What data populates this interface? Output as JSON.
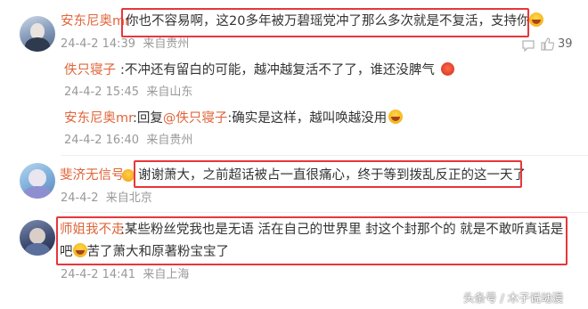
{
  "comments": [
    {
      "username": "安东尼奥mr",
      "text_before": "你也不容易啊，这20多年被万碧瑶党冲了那么多次就是不复活，支持你",
      "time": "24-4-2 14:39",
      "location": "来自贵州",
      "like_count": "39",
      "replies": [
        {
          "username": "佚只寝子",
          "text": ":不冲还有留白的可能，越冲越复活不了了，谁还没脾气",
          "time": "24-4-2 15:45",
          "location": "来自山东"
        },
        {
          "username": "安东尼奥mr",
          "text_before": ":回复",
          "mention": "@佚只寝子",
          "text_after": ":确实是这样，越叫唤越没用",
          "time": "24-4-2 16:40",
          "location": "来自贵州"
        }
      ]
    },
    {
      "username": "斐济无信号",
      "text": "谢谢萧大，之前超话被占一直很痛心，终于等到拨乱反正的这一天了",
      "time": "24-4-2",
      "location": "来自北京"
    },
    {
      "username": "师姐我不走",
      "text_line1": ":某些粉丝党我也是无语  活在自己的世界里  封这个封那个的    就是不敢听真话是",
      "text_line2_before": "吧",
      "text_line2_after": "苦了萧大和原著粉宝宝了",
      "time": "24-4-2 14:41",
      "location": "来自上海"
    }
  ],
  "watermark": "头条号 / 木子说动漫",
  "colors": {
    "accent": "#e0653a",
    "highlight": "#e8363a",
    "meta": "#999999"
  }
}
